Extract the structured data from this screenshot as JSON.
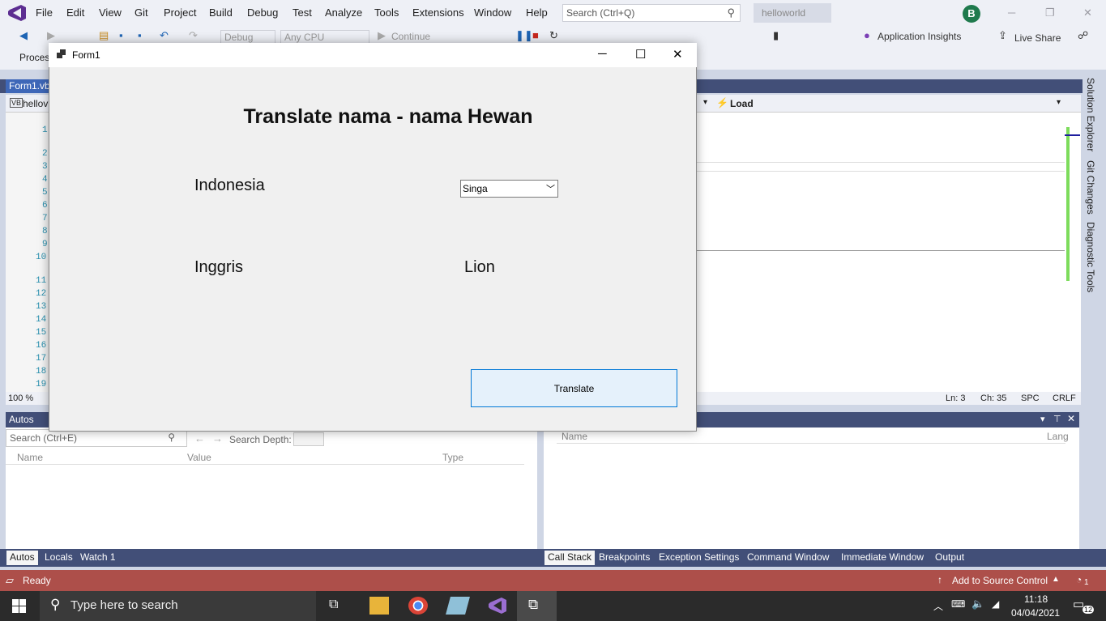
{
  "vs": {
    "menu": [
      "File",
      "Edit",
      "View",
      "Git",
      "Project",
      "Build",
      "Debug",
      "Test",
      "Analyze",
      "Tools",
      "Extensions",
      "Window",
      "Help"
    ],
    "search_placeholder": "Search (Ctrl+Q)",
    "solution_name": "helloworld",
    "avatar_letter": "B",
    "toolbar": {
      "config": "Debug",
      "platform": "Any CPU",
      "continue_label": "Continue",
      "app_insights": "Application Insights",
      "live_share": "Live Share",
      "process_label": "Proces"
    },
    "editor": {
      "tab": "Form1.vb",
      "project_combo": "hellov",
      "method_combo": "Load",
      "line_numbers": [
        "1",
        "2",
        "3",
        "4",
        "5",
        "6",
        "7",
        "8",
        "9",
        "10",
        "11",
        "12",
        "13",
        "14",
        "15",
        "16",
        "17",
        "18",
        "19"
      ],
      "zoom": "100 %",
      "ln": "Ln: 3",
      "ch": "Ch: 35",
      "spc": "SPC",
      "crlf": "CRLF"
    },
    "side_tabs": [
      "Solution Explorer",
      "Git Changes",
      "Diagnostic Tools"
    ],
    "autos": {
      "title": "Autos",
      "search_placeholder": "Search (Ctrl+E)",
      "search_depth": "Search Depth:",
      "columns": [
        "Name",
        "Value",
        "Type"
      ],
      "tabs": [
        "Autos",
        "Locals",
        "Watch 1"
      ]
    },
    "callstack": {
      "columns": [
        "Name",
        "Lang"
      ],
      "tabs": [
        "Call Stack",
        "Breakpoints",
        "Exception Settings",
        "Command Window",
        "Immediate Window",
        "Output"
      ]
    },
    "status": {
      "ready": "Ready",
      "source_control": "Add to Source Control",
      "notif_count": "1"
    }
  },
  "form": {
    "title": "Form1",
    "heading": "Translate nama - nama Hewan",
    "label_indonesia": "Indonesia",
    "label_inggris": "Inggris",
    "combo_value": "Singa",
    "result": "Lion",
    "button": "Translate"
  },
  "taskbar": {
    "search_placeholder": "Type here to search",
    "time": "11:18",
    "date": "04/04/2021",
    "notif_count": "12"
  }
}
